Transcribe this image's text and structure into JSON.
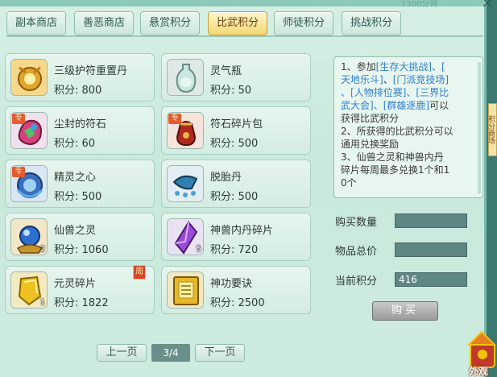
{
  "window": {
    "top_number": "1300分钟",
    "close_icon": "×",
    "side_tab_label": "积分商场"
  },
  "tabs": [
    {
      "label": "副本商店",
      "active": false
    },
    {
      "label": "善恶商店",
      "active": false
    },
    {
      "label": "悬赏积分",
      "active": false
    },
    {
      "label": "比武积分",
      "active": true
    },
    {
      "label": "师徒积分",
      "active": false
    },
    {
      "label": "挑战积分",
      "active": false
    }
  ],
  "items": [
    {
      "name": "三级护符重置丹",
      "price": "积分: 800",
      "icon": "gold-amulet-icon",
      "special": false,
      "count": "",
      "weekly": false
    },
    {
      "name": "灵气瓶",
      "price": "积分: 50",
      "icon": "vase-icon",
      "special": false,
      "count": "",
      "weekly": false
    },
    {
      "name": "尘封的符石",
      "price": "积分: 60",
      "icon": "rune-stone-icon",
      "special": true,
      "count": "",
      "weekly": false
    },
    {
      "name": "符石碎片包",
      "price": "积分: 500",
      "icon": "pouch-icon",
      "special": true,
      "count": "",
      "weekly": false
    },
    {
      "name": "精灵之心",
      "price": "积分: 500",
      "icon": "spirit-heart-icon",
      "special": true,
      "count": "",
      "weekly": false
    },
    {
      "name": "脱胎丹",
      "price": "积分: 500",
      "icon": "pill-icon",
      "special": false,
      "count": "",
      "weekly": false
    },
    {
      "name": "仙兽之灵",
      "price": "积分: 1060",
      "icon": "orb-icon",
      "special": false,
      "count": "2",
      "weekly": false
    },
    {
      "name": "神兽内丹碎片",
      "price": "积分: 720",
      "icon": "crystal-shard-icon",
      "special": false,
      "count": "5",
      "weekly": false
    },
    {
      "name": "元灵碎片",
      "price": "积分: 1822",
      "icon": "gold-shard-icon",
      "special": false,
      "count": "1",
      "weekly": true
    },
    {
      "name": "神功要诀",
      "price": "积分: 2500",
      "icon": "book-icon",
      "special": false,
      "count": "",
      "weekly": false
    }
  ],
  "badges": {
    "special": "专",
    "weekly": "周"
  },
  "info": {
    "l1a": "1、参加",
    "l1b": "[生存大挑战]",
    "l1c": "、[",
    "l2a": "天地乐斗]",
    "l2b": "、",
    "l2c": "[门派竞技场]",
    "l3a": "、",
    "l3b": "[人物排位赛]",
    "l3c": "、",
    "l3d": "[三界比",
    "l4a": "武大会]",
    "l4b": "、",
    "l4c": "[群雄逐鹿]",
    "l4d": "可以",
    "l5": "获得比武积分",
    "l6": "2、所获得的比武积分可以",
    "l7": "通用兑换奖励",
    "l8": "3、仙兽之灵和神兽内丹",
    "l9": "碎片每周最多兑换1个和1",
    "l10": "0个"
  },
  "form": {
    "buy_qty_label": "购买数量",
    "buy_qty_value": "",
    "total_label": "物品总价",
    "total_value": "",
    "current_label": "当前积分",
    "current_value": "416",
    "buy_button": "购买"
  },
  "pagination": {
    "prev": "上一页",
    "page": "3/4",
    "next": "下一页"
  },
  "deco_label": "外观商"
}
